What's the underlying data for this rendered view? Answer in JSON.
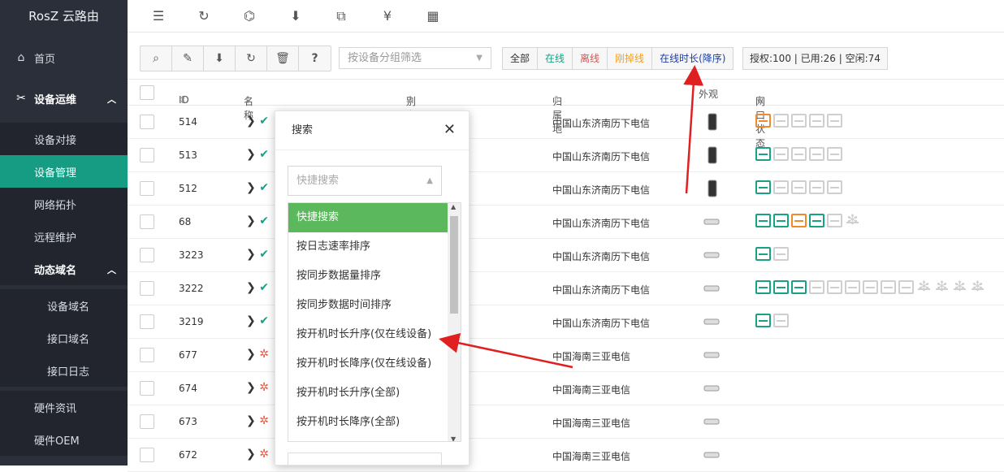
{
  "app": {
    "title": "RosZ 云路由"
  },
  "sidebar": {
    "items": [
      {
        "label": "首页"
      },
      {
        "label": "设备运维"
      },
      {
        "label": "设备对接"
      },
      {
        "label": "设备管理"
      },
      {
        "label": "网络拓扑"
      },
      {
        "label": "远程维护"
      },
      {
        "label": "动态域名"
      },
      {
        "label": "设备域名"
      },
      {
        "label": "接口域名"
      },
      {
        "label": "接口日志"
      },
      {
        "label": "硬件资讯"
      },
      {
        "label": "硬件OEM"
      }
    ]
  },
  "toolbar": {
    "question": "?",
    "group_filter_placeholder": "按设备分组筛选",
    "filters": [
      "全部",
      "在线",
      "离线",
      "刚掉线",
      "在线时长(降序)"
    ],
    "auth": "授权:100 | 已用:26 | 空闲:74"
  },
  "colors": {
    "online": "#1aa085",
    "offline": "#d9534f",
    "dropped": "#f0a020",
    "sort": "#1a3ea8",
    "accent": "#159c83"
  },
  "table": {
    "headers": {
      "id": "ID",
      "name": "名称",
      "alias": "别名 (可编辑)",
      "location": "归属地",
      "look": "外观",
      "ports": "网口状态"
    },
    "rows": [
      {
        "id": "514",
        "loc": "中国山东济南历下电信",
        "status": "online"
      },
      {
        "id": "513",
        "loc": "中国山东济南历下电信",
        "status": "online"
      },
      {
        "id": "512",
        "loc": "中国山东济南历下电信",
        "status": "online"
      },
      {
        "id": "68",
        "loc": "中国山东济南历下电信",
        "status": "online"
      },
      {
        "id": "3223",
        "loc": "中国山东济南历下电信",
        "status": "online"
      },
      {
        "id": "3222",
        "loc": "中国山东济南历下电信",
        "status": "online"
      },
      {
        "id": "3219",
        "loc": "中国山东济南历下电信",
        "status": "online"
      },
      {
        "id": "677",
        "loc": "中国海南三亚电信",
        "status": "offline"
      },
      {
        "id": "674",
        "loc": "中国海南三亚电信",
        "status": "offline"
      },
      {
        "id": "673",
        "loc": "中国海南三亚电信",
        "status": "offline"
      },
      {
        "id": "672",
        "loc": "中国海南三亚电信",
        "status": "offline"
      }
    ]
  },
  "modal": {
    "title": "搜索",
    "quick_search_placeholder": "快捷搜索",
    "options": [
      "快捷搜索",
      "按日志速率排序",
      "按同步数据量排序",
      "按同步数据时间排序",
      "按开机时长升序(仅在线设备)",
      "按开机时长降序(仅在线设备)",
      "按开机时长升序(全部)",
      "按开机时长降序(全部)"
    ]
  }
}
